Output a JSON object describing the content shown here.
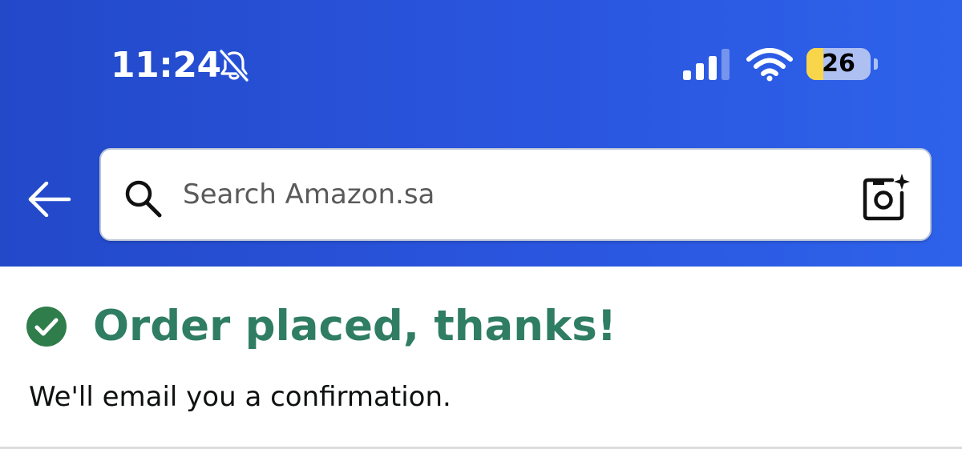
{
  "status_bar": {
    "time": "11:24",
    "silent_icon": "bell-slash-icon",
    "signal_icon": "cellular-signal-icon",
    "signal_bars_active": 3,
    "signal_bars_total": 4,
    "wifi_icon": "wifi-icon",
    "battery_icon": "battery-icon",
    "battery_level": "26",
    "battery_fraction": 0.26,
    "battery_fill_color": "#f9d54a"
  },
  "header": {
    "background_color": "#2a55de",
    "back_icon": "arrow-left-icon",
    "search": {
      "placeholder": "Search Amazon.sa",
      "value": "",
      "search_icon": "search-icon",
      "camera_icon": "camera-sparkle-icon"
    }
  },
  "order": {
    "status_icon": "check-circle-icon",
    "status_color": "#2f7d62",
    "title": "Order placed, thanks!",
    "message": "We'll email you a confirmation."
  }
}
